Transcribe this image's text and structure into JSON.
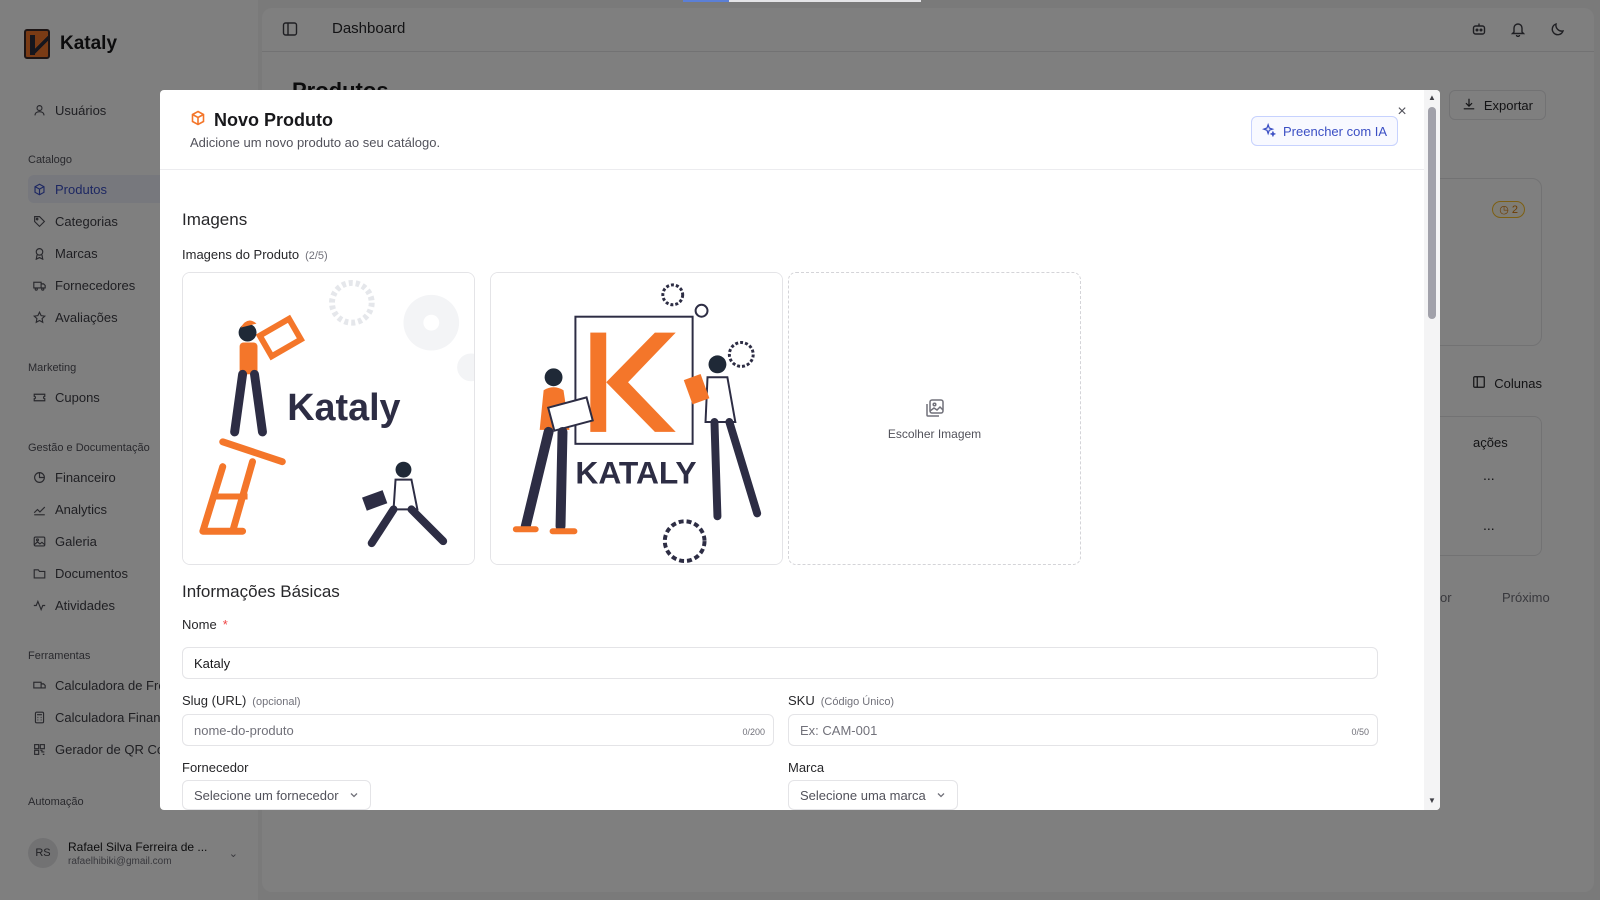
{
  "app": {
    "name": "Kataly"
  },
  "sidebar": {
    "top_item": "Usuários",
    "sections": [
      {
        "label": "Catalogo",
        "items": [
          "Produtos",
          "Categorias",
          "Marcas",
          "Fornecedores",
          "Avaliações"
        ]
      },
      {
        "label": "Marketing",
        "items": [
          "Cupons"
        ]
      },
      {
        "label": "Gestão e Documentação",
        "items": [
          "Financeiro",
          "Analytics",
          "Galeria",
          "Documentos",
          "Atividades"
        ]
      },
      {
        "label": "Ferramentas",
        "items": [
          "Calculadora de Fre",
          "Calculadora Financ",
          "Gerador de QR Cod"
        ]
      },
      {
        "label": "Automação",
        "items": []
      }
    ],
    "user": {
      "initials": "RS",
      "name": "Rafael Silva Ferreira de ...",
      "email": "rafaelhibiki@gmail.com"
    }
  },
  "topbar": {
    "title": "Dashboard"
  },
  "page": {
    "title": "Produtos",
    "export_label": "Exportar",
    "badge_count": "2",
    "columns_label": "Colunas",
    "actions_header": "ações",
    "row_actions": [
      "...",
      "..."
    ],
    "pager_prev": "terior",
    "pager_next": "Próximo"
  },
  "modal": {
    "title": "Novo Produto",
    "subtitle": "Adicione um novo produto ao seu catálogo.",
    "ai_button": "Preencher com IA",
    "close": "×",
    "images_section": "Imagens",
    "images_label": "Imagens do Produto",
    "images_count": "(2/5)",
    "image_1_wordmark": "Kataly",
    "image_2_wordmark": "KATALY",
    "upload_label": "Escolher Imagem",
    "basic_section": "Informações Básicas",
    "name_label": "Nome",
    "name_required": "*",
    "name_value": "Kataly",
    "slug_label": "Slug (URL)",
    "slug_hint": "(opcional)",
    "slug_placeholder": "nome-do-produto",
    "slug_counter": "0/200",
    "sku_label": "SKU",
    "sku_hint": "(Código Único)",
    "sku_placeholder": "Ex: CAM-001",
    "sku_counter": "0/50",
    "supplier_label": "Fornecedor",
    "supplier_placeholder": "Selecione um fornecedor",
    "brand_label": "Marca",
    "brand_placeholder": "Selecione uma marca"
  },
  "colors": {
    "accent": "#3b4fc4",
    "brand_orange": "#f4762a",
    "required": "#ef4444"
  }
}
